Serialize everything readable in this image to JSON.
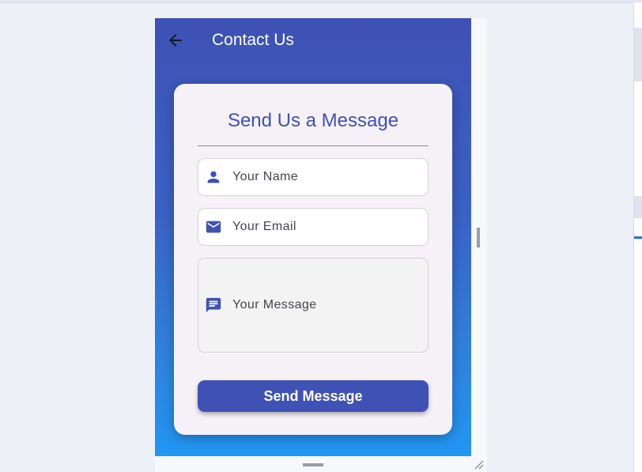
{
  "colors": {
    "primary": "#3f51b5",
    "gradient_bottom": "#2196f3",
    "card_background": "#f5f1f7"
  },
  "app_bar": {
    "title": "Contact Us",
    "back_icon": "arrow-back-icon"
  },
  "form": {
    "heading": "Send Us a Message",
    "fields": {
      "name": {
        "placeholder": "Your Name",
        "icon": "person-icon"
      },
      "email": {
        "placeholder": "Your Email",
        "icon": "email-icon"
      },
      "message": {
        "placeholder": "Your Message",
        "icon": "message-icon"
      }
    },
    "submit_label": "Send Message"
  }
}
